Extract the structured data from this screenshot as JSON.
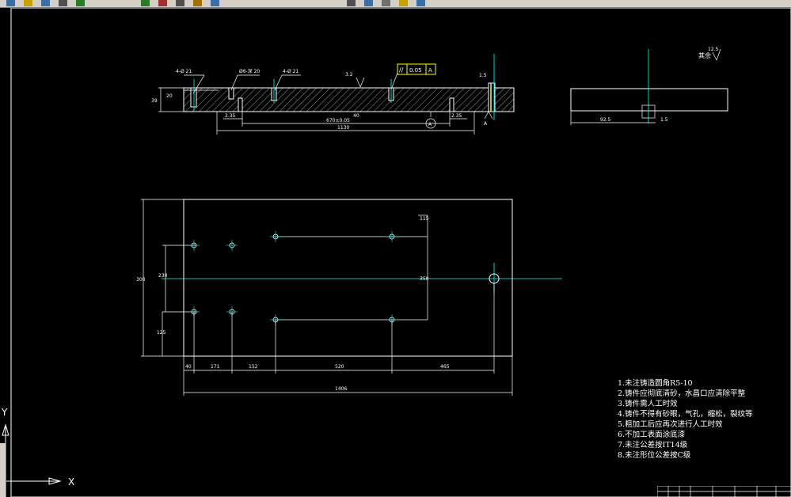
{
  "toolbar": {
    "icons": [
      "new-icon",
      "open-icon",
      "save-icon",
      "print-icon",
      "undo-icon",
      "redo-icon",
      "cut-icon",
      "copy-icon",
      "paste-icon",
      "match-icon",
      "pan-icon",
      "zoom-icon",
      "properties-icon",
      "layer-icon",
      "help-icon"
    ]
  },
  "drawing": {
    "colors": {
      "background": "#000000",
      "lines": "#ffffff",
      "centerline": "#00ffff",
      "marker": "#ffff00"
    },
    "section_view": {
      "hole_callouts": [
        "4-Ø 21",
        "Ø6-深 20",
        "4-Ø 21"
      ],
      "roughness": [
        "3.2",
        "6.3"
      ],
      "tolerance_frame": {
        "symbol": "//",
        "value": "0.05",
        "datum": "A"
      },
      "datum_label": "A",
      "dims": {
        "thickness": "39",
        "left_small": "20",
        "bottom_left": "2.35",
        "center": "670±0.05",
        "bottom_right": "2.35",
        "width_total": "1130",
        "hole_depth": "40",
        "right_tag": "1.5"
      }
    },
    "side_view": {
      "roughness_note": "其余",
      "roughness": "12.5",
      "dims": [
        "92.5",
        "1.5"
      ]
    },
    "plan_view": {
      "dims": {
        "height_total": "300",
        "left_inner": "230",
        "left_lower": "125",
        "right_top": "115",
        "right_mid": "350",
        "bottom": [
          "40",
          "171",
          "152",
          "520",
          "465"
        ],
        "overall": "1406"
      }
    },
    "notes": [
      "1.未注铸造圆角R5-10",
      "2.铸件应彻底清砂，水昌口应清除平整",
      "3.铸件需人工时效",
      "4.铸件不得有砂眼，气孔，缩松，裂纹等",
      "5.粗加工后应再次进行人工时效",
      "6.不加工表面涂底漆",
      "7.未注公差按IT14级",
      "8.未注形位公差按C级"
    ],
    "ucs": {
      "x_label": "X",
      "y_label": "Y"
    }
  }
}
